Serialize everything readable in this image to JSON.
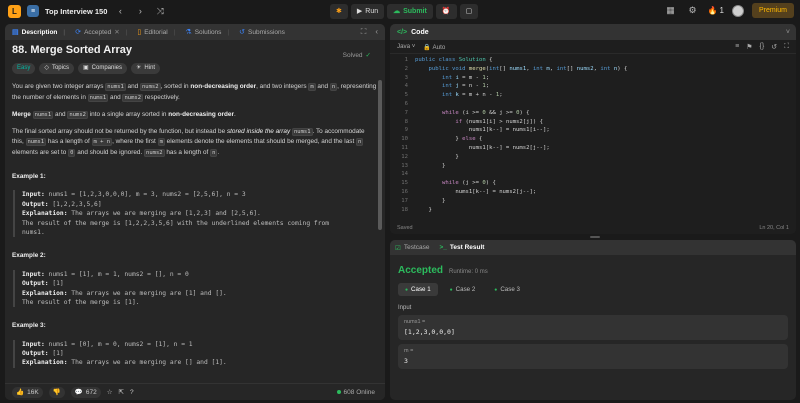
{
  "topbar": {
    "list_title": "Top Interview 150",
    "run_label": "Run",
    "submit_label": "Submit",
    "streak_count": "1",
    "premium_label": "Premium"
  },
  "left": {
    "tabs": [
      {
        "label": "Description"
      },
      {
        "label": "Accepted"
      },
      {
        "label": "Editorial"
      },
      {
        "label": "Solutions"
      },
      {
        "label": "Submissions"
      }
    ],
    "title": "88. Merge Sorted Array",
    "solved_label": "Solved",
    "chips": {
      "difficulty": "Easy",
      "topics": "Topics",
      "companies": "Companies",
      "hint": "Hint"
    },
    "description": {
      "p1_a": "You are given two integer arrays ",
      "nums1": "nums1",
      "p1_and": " and ",
      "nums2": "nums2",
      "p1_b": ", sorted in ",
      "p1_bold": "non-decreasing order",
      "p1_c": ", and two integers ",
      "m": "m",
      "n": "n",
      "p1_d": ", representing the number of elements in ",
      "p1_e": " respectively.",
      "p2_merge": "Merge",
      "p2_into": " into a single array sorted in ",
      "p2_dot": ".",
      "p3_a": "The final sorted array should not be returned by the function, but instead be ",
      "p3_italic": "stored inside the array",
      "p3_b": ". To accommodate this, ",
      "p3_c": " has a length of ",
      "m_plus_n": "m + n",
      "p3_d": ", where the first ",
      "p3_e": " elements denote the elements that should be merged, and the last ",
      "p3_f": " elements are set to ",
      "zero": "0",
      "p3_g": " and should be ignored. ",
      "p3_h": " has a length of ",
      "p3_end": "."
    },
    "examples": [
      {
        "heading": "Example 1:",
        "input_label": "Input:",
        "input": " nums1 = [1,2,3,0,0,0], m = 3, nums2 = [2,5,6], n = 3",
        "output_label": "Output:",
        "output": " [1,2,2,3,5,6]",
        "explanation_label": "Explanation:",
        "explanation": " The arrays we are merging are [1,2,3] and [2,5,6].",
        "explanation_2": "The result of the merge is [1,2,2,3,5,6] with the underlined elements coming from",
        "explanation_3": "nums1."
      },
      {
        "heading": "Example 2:",
        "input_label": "Input:",
        "input": " nums1 = [1], m = 1, nums2 = [], n = 0",
        "output_label": "Output:",
        "output": " [1]",
        "explanation_label": "Explanation:",
        "explanation": " The arrays we are merging are [1] and [].",
        "explanation_2": "The result of the merge is [1]."
      },
      {
        "heading": "Example 3:",
        "input_label": "Input:",
        "input": " nums1 = [0], m = 0, nums2 = [1], n = 1",
        "output_label": "Output:",
        "output": " [1]",
        "explanation_label": "Explanation:",
        "explanation": " The arrays we are merging are [] and [1]."
      }
    ],
    "footer": {
      "likes": "16K",
      "comments": "672",
      "online": "608 Online"
    }
  },
  "code": {
    "header": "Code",
    "language": "Java",
    "mode": "Auto",
    "status_saved": "Saved",
    "cursor": "Ln 20, Col 1",
    "line_numbers": [
      "1",
      "2",
      "3",
      "4",
      "5",
      "6",
      "7",
      "8",
      "9",
      "10",
      "11",
      "12",
      "13",
      "14",
      "15",
      "16",
      "17",
      "18"
    ]
  },
  "test": {
    "tab_testcase": "Testcase",
    "tab_result": "Test Result",
    "status": "Accepted",
    "runtime": "Runtime: 0 ms",
    "cases": [
      "Case 1",
      "Case 2",
      "Case 3"
    ],
    "input_label": "Input",
    "param1_name": "nums1 =",
    "param1_value": "[1,2,3,0,0,0]",
    "param2_name": "m =",
    "param2_value": "3"
  }
}
